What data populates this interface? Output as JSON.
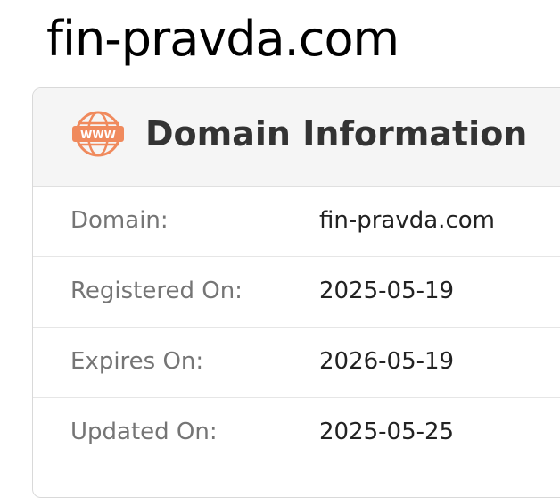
{
  "page": {
    "title": "fin-pravda.com"
  },
  "card": {
    "title": "Domain Information",
    "icon": "www-globe-icon",
    "icon_text": "WWW",
    "accent_color": "#f08a5d"
  },
  "rows": [
    {
      "label": "Domain:",
      "value": "fin-pravda.com"
    },
    {
      "label": "Registered On:",
      "value": "2025-05-19"
    },
    {
      "label": "Expires On:",
      "value": "2026-05-19"
    },
    {
      "label": "Updated On:",
      "value": "2025-05-25"
    }
  ]
}
